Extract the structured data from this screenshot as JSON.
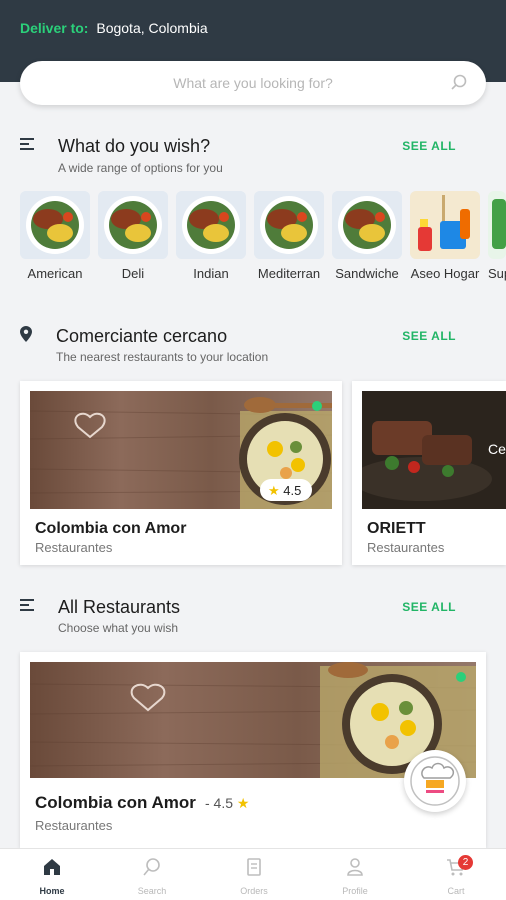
{
  "header": {
    "deliver_label": "Deliver to:",
    "location": "Bogota, Colombia"
  },
  "search": {
    "placeholder": "What are you looking for?"
  },
  "wish": {
    "title": "What do you wish?",
    "subtitle": "A wide range of options for you",
    "see_all": "SEE ALL",
    "categories": [
      "American",
      "Deli",
      "Indian",
      "Mediterran",
      "Sandwiche",
      "Aseo Hogar",
      "Sup"
    ]
  },
  "nearby": {
    "title": "Comerciante cercano",
    "subtitle": "The nearest restaurants to your location",
    "see_all": "SEE ALL",
    "cards": [
      {
        "name": "Colombia con Amor",
        "category": "Restaurantes",
        "rating": "4.5"
      },
      {
        "name": "ORIETT",
        "category": "Restaurantes",
        "overlay": "Ce"
      }
    ]
  },
  "all": {
    "title": "All Restaurants",
    "subtitle": "Choose what you wish",
    "see_all": "SEE ALL",
    "card": {
      "name": "Colombia con Amor",
      "rating_text": "- 4.5",
      "category": "Restaurantes"
    }
  },
  "nav": {
    "items": [
      "Home",
      "Search",
      "Orders",
      "Profile",
      "Cart"
    ],
    "cart_badge": "2"
  },
  "colors": {
    "header_bg": "#2f3a44",
    "accent_green": "#22b566",
    "rating_star": "#f2c200",
    "badge_red": "#e53935"
  }
}
